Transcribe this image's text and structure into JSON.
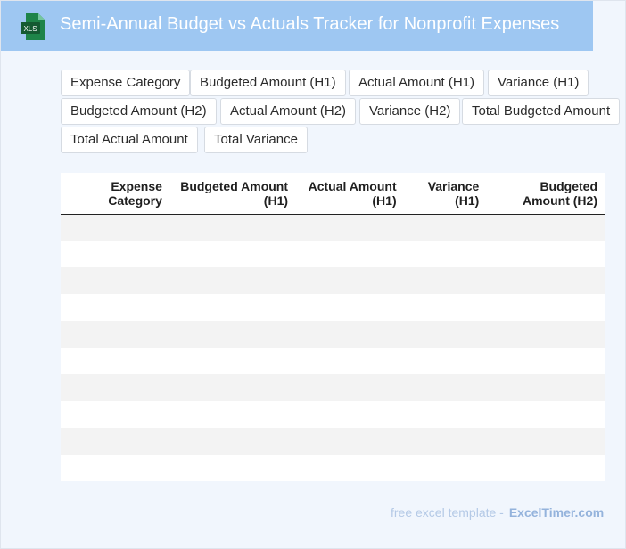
{
  "header": {
    "title": "Semi-Annual Budget vs Actuals Tracker for Nonprofit Expenses",
    "icon": "xls-file-icon",
    "icon_label": "XLS",
    "header_color": "#9ec7f2"
  },
  "chips": [
    "Expense Category",
    "Budgeted Amount (H1)",
    "Actual Amount (H1)",
    "Variance (H1)",
    "Budgeted Amount (H2)",
    "Actual Amount (H2)",
    "Variance (H2)",
    "Total Budgeted Amount",
    "Total Actual Amount",
    "Total Variance"
  ],
  "table": {
    "columns": [
      "",
      "Expense Category",
      "Budgeted Amount (H1)",
      "Actual Amount (H1)",
      "Variance (H1)",
      "Budgeted Amount (H2)"
    ],
    "row_count": 10
  },
  "footer": {
    "prefix": "free excel template -",
    "brand": "ExcelTimer.com"
  }
}
